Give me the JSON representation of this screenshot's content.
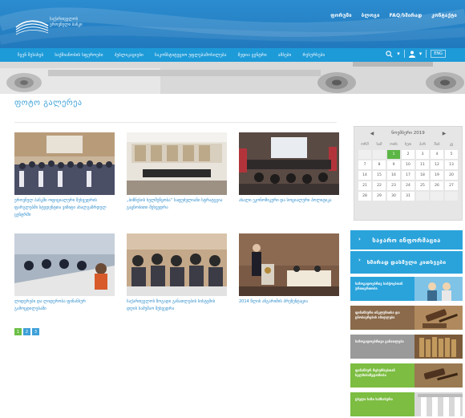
{
  "header": {
    "logo_text": "საქართველოს ეროვნული ბანკი",
    "top_links": [
      "ფორუმი",
      "ბლოგი",
      "FAQ/ხშირად",
      "კონტაქტი"
    ]
  },
  "nav": {
    "items": [
      "ჩვენ შესახებ",
      "საქმიანობის სფეროები",
      "პუბლიკაციები",
      "საკონსტიტუციო უფლებამოსილება",
      "მედია ცენტრი",
      "ამბები",
      "რესურსები"
    ],
    "lang": "ENG"
  },
  "page": {
    "title": "ფოტო გალერეა"
  },
  "gallery": [
    {
      "caption": "ეროვნულ ბანკში ოფიციალური შეხვედრის ფარგლებში სტუდენტთა ვიზიტი ახალგაზრდულ ცენტრში"
    },
    {
      "caption": "„ბიზნესის ხელშეწყობა“ საფუძვლიანი სტრატეგია გაცნობითი შეხვედრა"
    },
    {
      "caption": "ახალი ეკონომიკური და სოციალური პოლიტიკა"
    },
    {
      "caption": "ლიდერები და ლიდერობა ფინანსურ გამოცდილებაში"
    },
    {
      "caption": "საქართველოს ზოგადი განათლების სისტემის დღის სამუშაო შეხვედრა"
    },
    {
      "caption": "2014 წლის ანგარიშის პრეზენტაცია"
    }
  ],
  "pager": [
    "1",
    "2",
    "3"
  ],
  "calendar": {
    "month_label": "ნოემბერი 2019",
    "prev": "◀",
    "next": "▶",
    "dow": [
      "ორშ",
      "სამ",
      "ოთხ",
      "ხუთ",
      "პარ",
      "შაბ",
      "კვ"
    ],
    "cells": [
      "",
      "",
      "",
      "",
      "",
      "",
      "",
      "",
      "",
      "1",
      "2",
      "3",
      "4",
      "5",
      "7",
      "8",
      "9",
      "10",
      "11",
      "12",
      "13",
      "14",
      "15",
      "16",
      "17",
      "18",
      "19",
      "20",
      "21",
      "22",
      "23",
      "24",
      "25",
      "26",
      "27",
      "28",
      "29",
      "30",
      "31",
      "",
      "",
      ""
    ],
    "today": "1"
  },
  "sidebar": {
    "btn1": "საჯარო ინფორმაცია",
    "btn2": "ხშირად დასმული კითხვები",
    "promos": [
      {
        "text": "საზოგადოებრივ საბჭოებთან ურთიერთობა",
        "color": "#2aa3db"
      },
      {
        "text": "ფინანსური ინკლუზიისა და ცნობიერების ამაღლება",
        "color": "#8a6a4a"
      },
      {
        "text": "საზოგადოებრივი განათლება",
        "color": "#9a9a9a"
      },
      {
        "text": "ფინანსურ რესურსებთან ხელმისაწვდომობა",
        "color": "#7cbd42"
      },
      {
        "text": "ცხელი ხაზი სამსახური",
        "color": "#7cbd42"
      }
    ]
  },
  "colors": {
    "header": "#2279bd",
    "nav": "#1d9ad8",
    "accent_green": "#5cb646",
    "link": "#2d8ccb"
  }
}
